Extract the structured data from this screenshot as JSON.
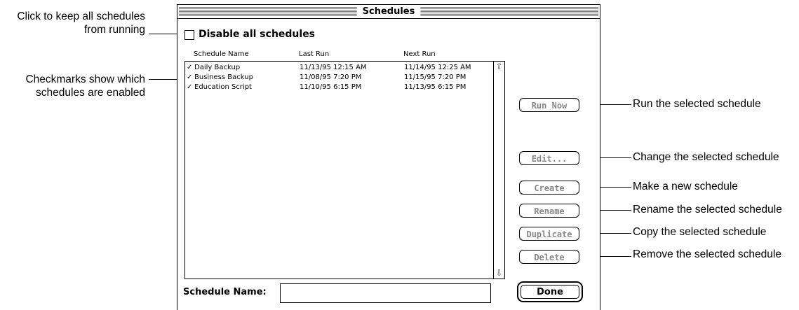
{
  "annotations": {
    "disable_all": [
      "Click to keep all schedules",
      "from running"
    ],
    "checkmarks": [
      "Checkmarks show which",
      "schedules are enabled"
    ],
    "run_now": "Run the selected schedule",
    "edit": "Change the selected schedule",
    "create": "Make a new schedule",
    "rename": "Rename the selected schedule",
    "duplicate": "Copy the selected schedule",
    "delete": "Remove the selected schedule"
  },
  "window": {
    "title": "Schedules",
    "disable_all_label": "Disable all schedules",
    "disable_all_checked": false,
    "columns": {
      "name": "Schedule Name",
      "last_run": "Last Run",
      "next_run": "Next Run"
    },
    "rows": [
      {
        "check": "✓",
        "name": "Daily Backup",
        "last_run": "11/13/95 12:15 AM",
        "next_run": "11/14/95 12:25 AM"
      },
      {
        "check": "✓",
        "name": "Business Backup",
        "last_run": "11/08/95 7:20 PM",
        "next_run": "11/15/95 7:20 PM"
      },
      {
        "check": "✓",
        "name": "Education Script",
        "last_run": "11/10/95 6:15 PM",
        "next_run": "11/13/95 6:15 PM"
      }
    ],
    "buttons": {
      "run_now": "Run Now",
      "edit": "Edit...",
      "create": "Create",
      "rename": "Rename",
      "duplicate": "Duplicate",
      "delete": "Delete",
      "done": "Done"
    },
    "schedule_name_label": "Schedule Name:",
    "schedule_name_value": "",
    "scroll_up": "⇧",
    "scroll_down": "⇩"
  }
}
